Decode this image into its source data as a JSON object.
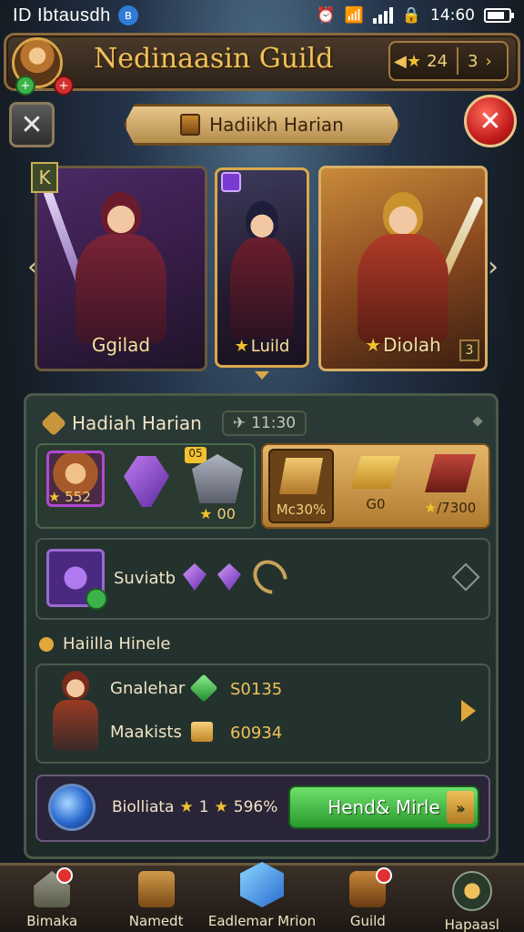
{
  "status_bar": {
    "carrier": "ID Ibtausdh",
    "bluetooth_icon": "bluetooth-icon",
    "time": "14:60"
  },
  "header": {
    "title": "Nedinaasin Guild",
    "currency_value": "24",
    "currency_page": "3"
  },
  "banner": {
    "title": "Hadiikh Harian"
  },
  "heroes": [
    {
      "label": "Ggilad",
      "corner_badge": "K"
    },
    {
      "label": "Luild"
    },
    {
      "label": "Diolah",
      "corner_number": "3"
    }
  ],
  "daily": {
    "title": "Hadiah Harian",
    "timer": "11:30",
    "items_left": [
      {
        "value": "552"
      },
      {
        "value": ""
      },
      {
        "value": "00",
        "tag": "05"
      }
    ],
    "items_right": [
      {
        "value": "Mc30%"
      },
      {
        "value": "G0"
      },
      {
        "value": "7300"
      }
    ]
  },
  "special": {
    "name": "Suviatb"
  },
  "section2": {
    "title": "Haiilla Hinele"
  },
  "quest": {
    "line1_name": "Gnalehar",
    "line1_value": "S0135",
    "line2_name": "Maakists",
    "line2_value": "60934"
  },
  "bonus": {
    "name": "Biolliata",
    "multiplier": "1",
    "percent": "596%",
    "button_label": "Hend& Mirle"
  },
  "nav": [
    {
      "label": "Bimaka"
    },
    {
      "label": "Namedt"
    },
    {
      "label": "Eadlemar Mrion"
    },
    {
      "label": "Guild"
    },
    {
      "label": "Hapaasl"
    }
  ]
}
